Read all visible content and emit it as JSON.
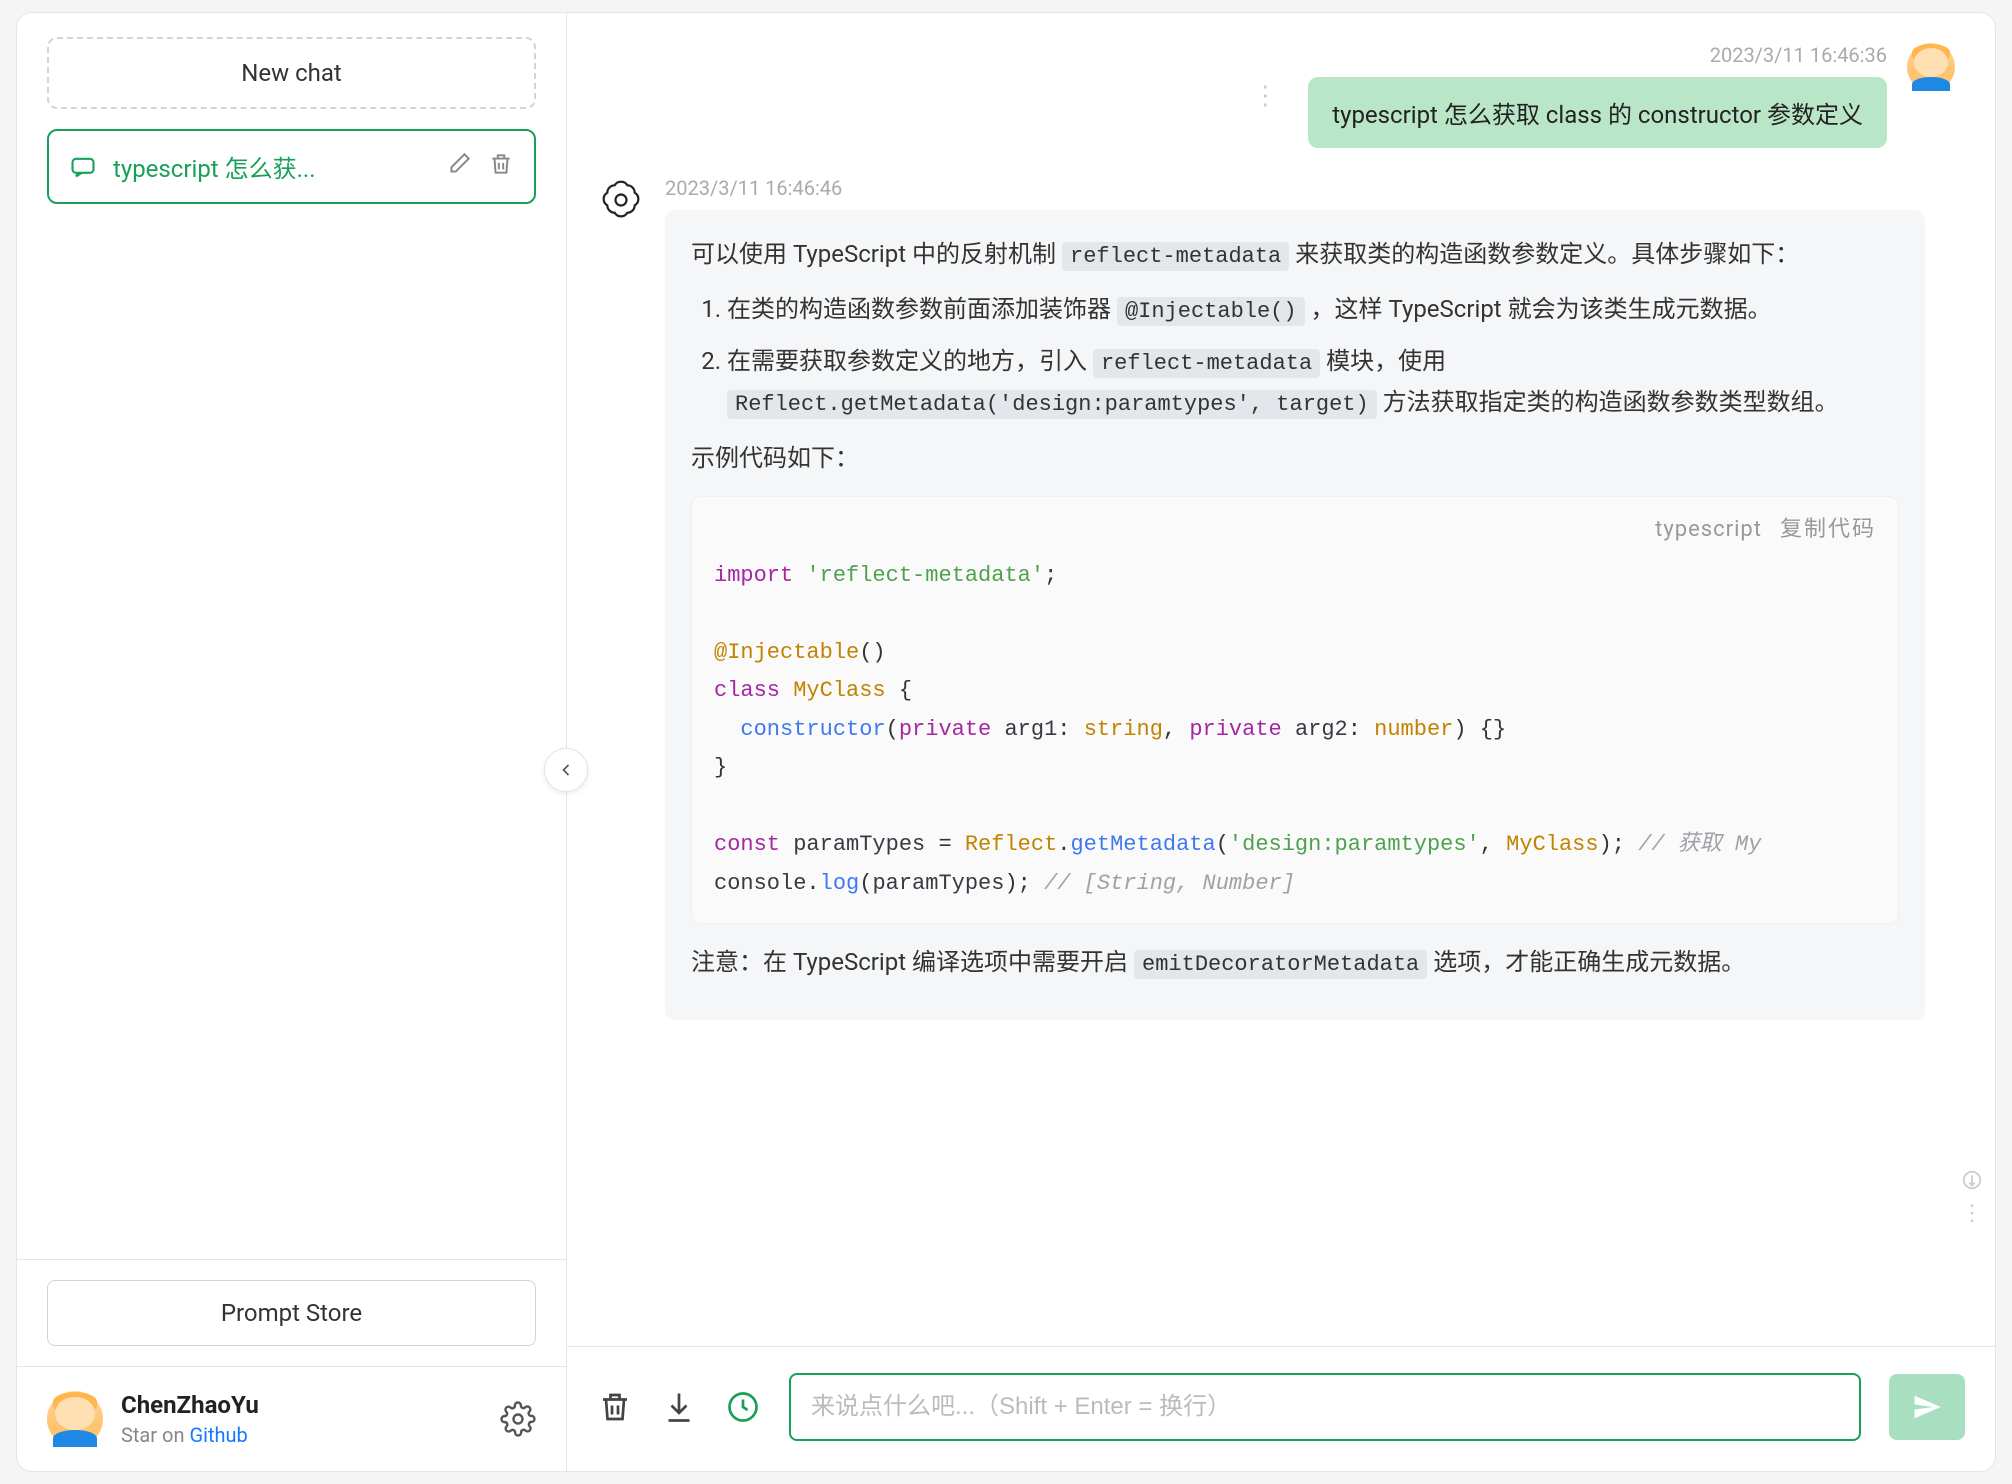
{
  "sidebar": {
    "new_chat_label": "New chat",
    "chat_item_title": "typescript 怎么获...",
    "prompt_store_label": "Prompt Store",
    "user": {
      "name": "ChenZhaoYu",
      "sub_prefix": "Star on ",
      "sub_link": "Github"
    }
  },
  "messages": {
    "user": {
      "time": "2023/3/11 16:46:36",
      "text": "typescript 怎么获取 class 的 constructor 参数定义"
    },
    "assistant": {
      "time": "2023/3/11 16:46:46",
      "intro_pre": "可以使用 TypeScript 中的反射机制 ",
      "intro_code": "reflect-metadata",
      "intro_post": " 来获取类的构造函数参数定义。具体步骤如下：",
      "step1_pre": "在类的构造函数参数前面添加装饰器 ",
      "step1_code": "@Injectable()",
      "step1_post": " ，这样 TypeScript 就会为该类生成元数据。",
      "step2_pre": "在需要获取参数定义的地方，引入 ",
      "step2_code1": "reflect-metadata",
      "step2_mid": " 模块，使用 ",
      "step2_code2": "Reflect.getMetadata('design:paramtypes', target)",
      "step2_post": " 方法获取指定类的构造函数参数类型数组。",
      "example_label": "示例代码如下：",
      "code": {
        "lang": "typescript",
        "copy_label": "复制代码",
        "line_import": "import",
        "line_import_str": "'reflect-metadata'",
        "decorator": "@Injectable",
        "decorator_call": "()",
        "class_kw": "class",
        "class_name": "MyClass",
        "constructor_kw": "constructor",
        "private_kw": "private",
        "arg1_name": "arg1",
        "arg1_type": "string",
        "arg2_name": "arg2",
        "arg2_type": "number",
        "const_kw": "const",
        "var_name": "paramTypes",
        "reflect_obj": "Reflect",
        "get_meta": "getMetadata",
        "meta_key": "'design:paramtypes'",
        "meta_target": "MyClass",
        "comment1": "// 获取 My",
        "console_obj": "console",
        "log_fn": "log",
        "log_arg": "paramTypes",
        "comment2": "// [String, Number]"
      },
      "note_pre": "注意：在 TypeScript 编译选项中需要开启 ",
      "note_code": "emitDecoratorMetadata",
      "note_post": " 选项，才能正确生成元数据。"
    }
  },
  "input": {
    "placeholder": "来说点什么吧...（Shift + Enter = 换行）"
  }
}
